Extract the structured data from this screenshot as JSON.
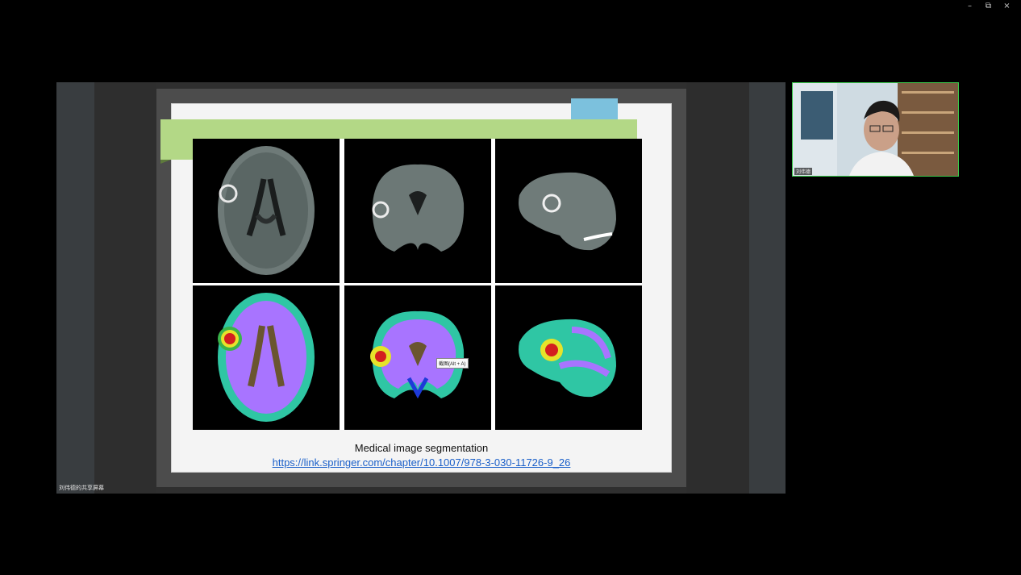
{
  "window": {
    "minimize": "–",
    "restore": "⧉",
    "close": "×"
  },
  "slide": {
    "caption": "Medical image segmentation",
    "link": "https://link.springer.com/chapter/10.1007/978-3-030-11726-9_26",
    "tooltip": "截图(Alt + A)"
  },
  "share_label": "刘伟德的共享屏幕",
  "camera": {
    "name": "刘伟德"
  },
  "colors": {
    "green_bar": "#b3d886",
    "blue_tab": "#7cc1dd",
    "seg_purple": "#a874ff",
    "seg_teal": "#2fc6a4",
    "tumor_red": "#d31f1f",
    "tumor_yellow": "#e6e32a",
    "camera_border": "#39c84a"
  }
}
